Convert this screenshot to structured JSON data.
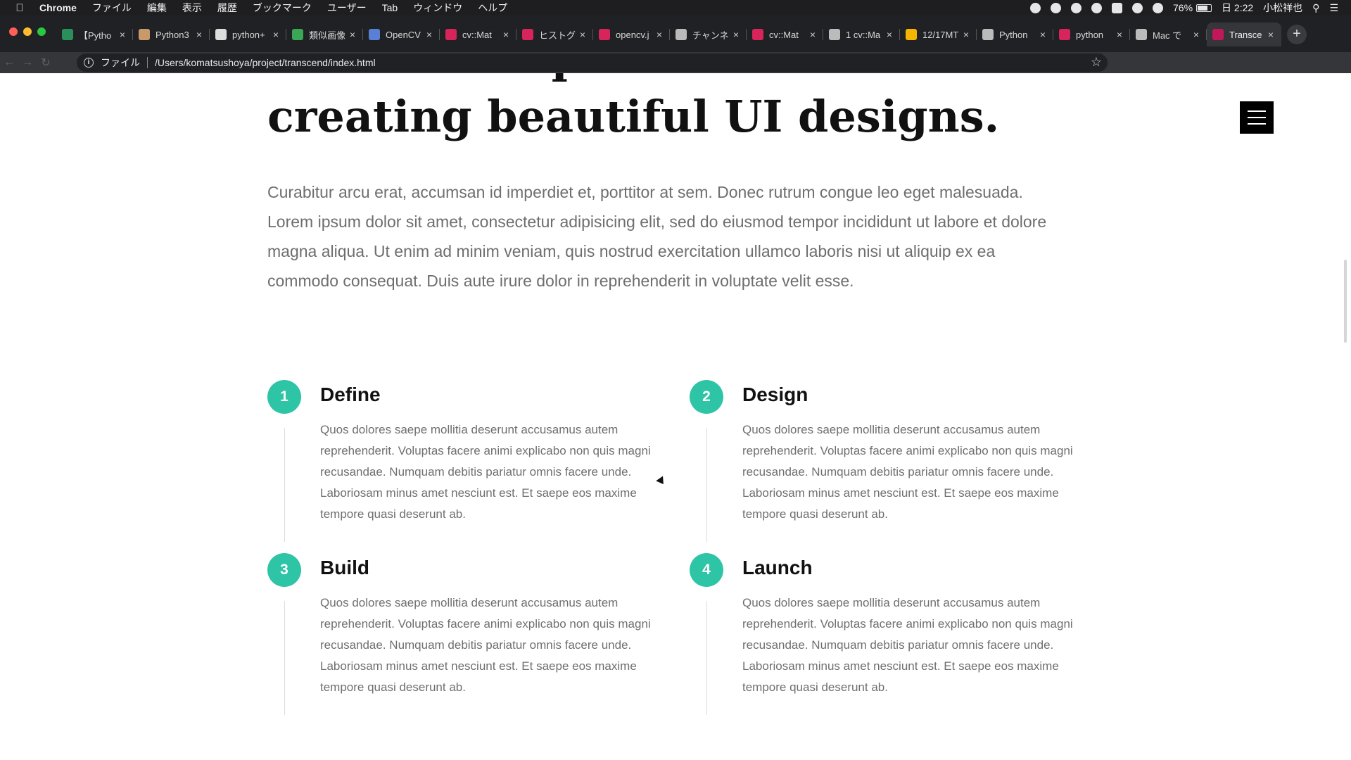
{
  "menubar": {
    "app_name": "Chrome",
    "items": [
      "ファイル",
      "編集",
      "表示",
      "履歴",
      "ブックマーク",
      "ユーザー",
      "Tab",
      "ウィンドウ",
      "ヘルプ"
    ],
    "battery_percent": "76%",
    "battery_level": 0.76,
    "clock": "日 2:22",
    "user_name": "小松祥也"
  },
  "tabs": [
    {
      "title": "【Pytho",
      "favicon_color": "#2a8f5b"
    },
    {
      "title": "Python3",
      "favicon_color": "#c89a6b"
    },
    {
      "title": "python+",
      "favicon_color": "#dddddd"
    },
    {
      "title": "類似画像",
      "favicon_color": "#3aa757"
    },
    {
      "title": "OpenCV",
      "favicon_color": "#5a7fd6"
    },
    {
      "title": "cv::Mat",
      "favicon_color": "#d7245b"
    },
    {
      "title": "ヒストグ",
      "favicon_color": "#d7245b"
    },
    {
      "title": "opencv.j",
      "favicon_color": "#d7245b"
    },
    {
      "title": "チャンネ",
      "favicon_color": "#bbbbbb"
    },
    {
      "title": "cv::Mat",
      "favicon_color": "#d7245b"
    },
    {
      "title": "1 cv::Ma",
      "favicon_color": "#bbbbbb"
    },
    {
      "title": "12/17MT",
      "favicon_color": "#f4b400"
    },
    {
      "title": "Python",
      "favicon_color": "#bbbbbb"
    },
    {
      "title": "python",
      "favicon_color": "#d7245b"
    },
    {
      "title": "Mac で",
      "favicon_color": "#bbbbbb"
    },
    {
      "title": "Transce",
      "favicon_color": "#c2185b",
      "active": true
    }
  ],
  "address_bar": {
    "scheme_label": "ファイル",
    "url": "/Users/komatsushoya/project/transcend/index.html"
  },
  "hero": {
    "headline": "individuals passionate about creating beautiful UI designs.",
    "lead": "Curabitur arcu erat, accumsan id imperdiet et, porttitor at sem. Donec rutrum congue leo eget malesuada. Lorem ipsum dolor sit amet, consectetur adipisicing elit, sed do eiusmod tempor incididunt ut labore et dolore magna aliqua. Ut enim ad minim veniam, quis nostrud exercitation ullamco laboris nisi ut aliquip ex ea commodo consequat. Duis aute irure dolor in reprehenderit in voluptate velit esse."
  },
  "accent_color": "#2ec4a6",
  "steps": [
    {
      "number": "1",
      "title": "Define",
      "text": "Quos dolores saepe mollitia deserunt accusamus autem reprehenderit. Voluptas facere animi explicabo non quis magni recusandae. Numquam debitis pariatur omnis facere unde. Laboriosam minus amet nesciunt est. Et saepe eos maxime tempore quasi deserunt ab."
    },
    {
      "number": "2",
      "title": "Design",
      "text": "Quos dolores saepe mollitia deserunt accusamus autem reprehenderit. Voluptas facere animi explicabo non quis magni recusandae. Numquam debitis pariatur omnis facere unde. Laboriosam minus amet nesciunt est. Et saepe eos maxime tempore quasi deserunt ab."
    },
    {
      "number": "3",
      "title": "Build",
      "text": "Quos dolores saepe mollitia deserunt accusamus autem reprehenderit. Voluptas facere animi explicabo non quis magni recusandae. Numquam debitis pariatur omnis facere unde. Laboriosam minus amet nesciunt est. Et saepe eos maxime tempore quasi deserunt ab."
    },
    {
      "number": "4",
      "title": "Launch",
      "text": "Quos dolores saepe mollitia deserunt accusamus autem reprehenderit. Voluptas facere animi explicabo non quis magni recusandae. Numquam debitis pariatur omnis facere unde. Laboriosam minus amet nesciunt est. Et saepe eos maxime tempore quasi deserunt ab."
    }
  ]
}
